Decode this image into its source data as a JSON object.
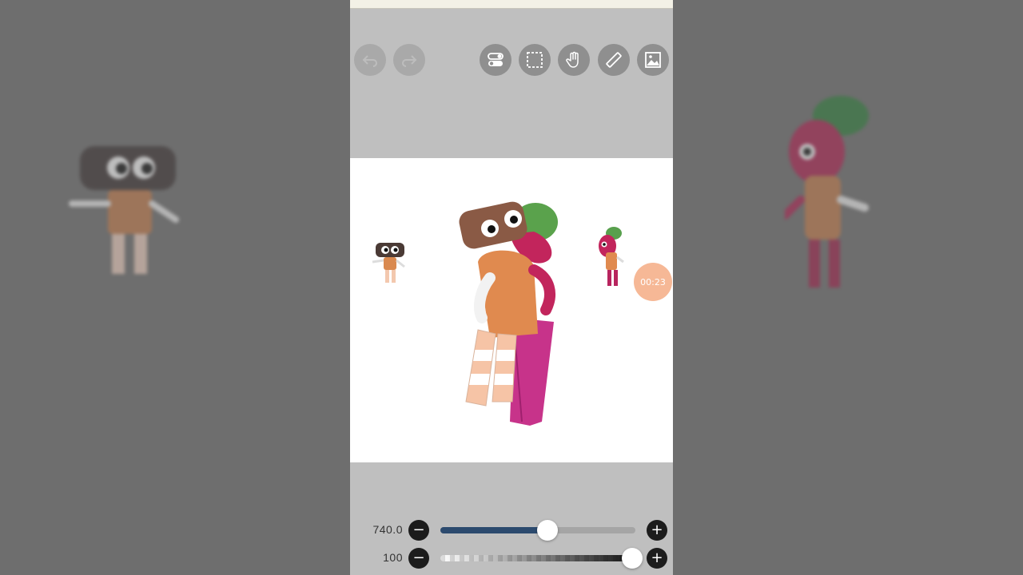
{
  "toolbar": {
    "icons": [
      "undo-icon",
      "redo-icon",
      "toggle-icon",
      "selection-icon",
      "hand-icon",
      "ruler-icon",
      "image-icon"
    ]
  },
  "timer": {
    "label": "00:23"
  },
  "brush_size": {
    "value": "740.0",
    "level": 0.55,
    "minus": "−",
    "plus": "+"
  },
  "opacity": {
    "value": "100",
    "level": 1.0,
    "minus": "−",
    "plus": "+"
  },
  "colors": {
    "accent": "#2c4a6e",
    "timer": "#f6b896",
    "canvas": "#ffffff",
    "toolbar_bg": "#bfbfbf"
  }
}
